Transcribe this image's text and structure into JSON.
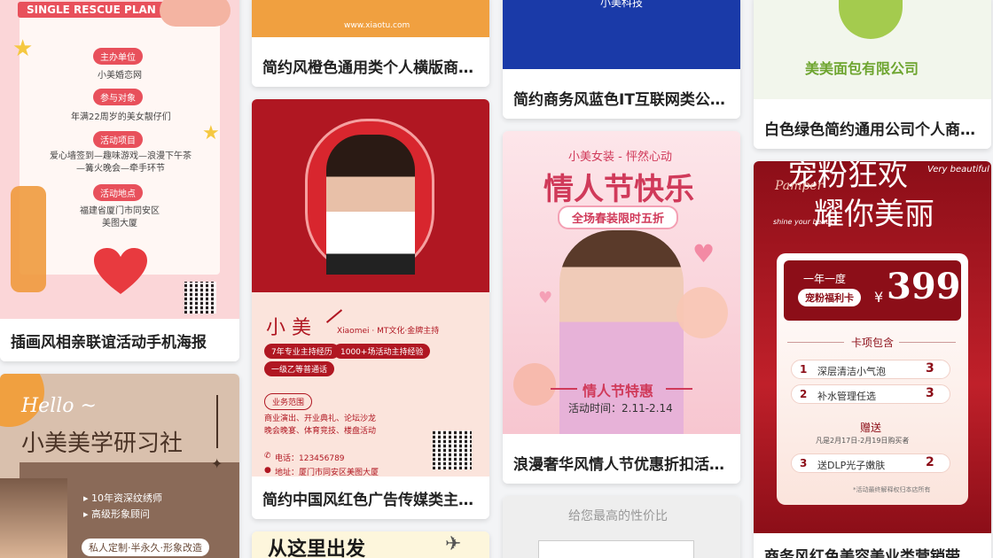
{
  "colors": {
    "page_bg": "#f3f4f6",
    "title_text": "#222222",
    "orange": "#f0a040",
    "blue": "#1a3aa8",
    "red": "#b01722",
    "pink": "#f7d4dc",
    "green": "#8bc34a"
  },
  "cards": [
    {
      "title": "插画风相亲联谊活动手机海报",
      "poster": {
        "banner": "SINGLE RESCUE PLAN",
        "sections": [
          {
            "label": "主办单位",
            "text": "小美婚恋网"
          },
          {
            "label": "参与对象",
            "text": "年满22周岁的美女靓仔们"
          },
          {
            "label": "活动项目",
            "text": "爱心墙签到—趣味游戏—浪漫下午茶\n—篝火晚会—牵手环节"
          },
          {
            "label": "活动地点",
            "text": "福建省厦门市同安区\n美图大厦"
          }
        ]
      }
    },
    {
      "title": "小美美学研习社",
      "poster": {
        "hello": "Hello ~",
        "heading": "小美美学研习社",
        "bullets": [
          "10年资深纹绣师",
          "高级形象顾问"
        ],
        "tag": "私人定制·半永久·形象改造"
      }
    },
    {
      "title": "简约风橙色通用类个人横版商…",
      "poster": {
        "url": "www.xiaotu.com"
      }
    },
    {
      "title": "简约中国风红色广告传媒类主…",
      "poster": {
        "name": "小 美",
        "subtitle": "Xiaomei · MT文化·金牌主持",
        "tags": [
          "7年专业主持经历",
          "1000+场活动主持经验",
          "一级乙等普通话"
        ],
        "section_label": "业务范围",
        "scope": "商业演出、开业典礼、论坛沙龙\n晚会晚宴、体育竞技、楼盘活动",
        "phone": "电话：123456789",
        "address": "地址：厦门市同安区美图大厦"
      }
    },
    {
      "title": "从这里出发",
      "poster": {
        "heading": "从这里出发"
      }
    },
    {
      "title": "简约商务风蓝色IT互联网类公…",
      "poster": {
        "company": "小美科技"
      }
    },
    {
      "title": "浪漫奢华风情人节优惠折扣活…",
      "poster": {
        "brand": "小美女装 - 怦然心动",
        "heading": "情人节快乐",
        "ribbon": "全场春装限时五折",
        "promo": "情人节特惠",
        "date": "活动时间：2.11-2.14"
      }
    },
    {
      "title": "给您最高的性价比",
      "poster": {
        "slogan": "给您最高的性价比"
      }
    },
    {
      "title": "白色绿色简约通用公司个人商…",
      "poster": {
        "company": "美美面包有限公司"
      }
    },
    {
      "title": "商务风红色美容美业类营销带…",
      "poster": {
        "head1": "宠粉狂欢",
        "head2": "耀你美丽",
        "script1": "Very beautiful",
        "script2": "Pamper",
        "script3": "shine your beauty",
        "card_label_top": "一年一度",
        "card_label": "宠粉福利卡",
        "currency": "¥",
        "price": "399",
        "includes": "卡项包含",
        "items": [
          {
            "n": "1",
            "name": "深层清洁小气泡",
            "count": "3"
          },
          {
            "n": "2",
            "name": "补水管理任选",
            "count": "3"
          }
        ],
        "gift": "赠送",
        "gift_note": "凡是2月17日-2月19日购买者",
        "gift_items": [
          {
            "n": "3",
            "name": "送DLP光子嫩肤",
            "count": "2"
          }
        ],
        "foot_note": "*活动最终解释权归本店所有"
      }
    }
  ]
}
